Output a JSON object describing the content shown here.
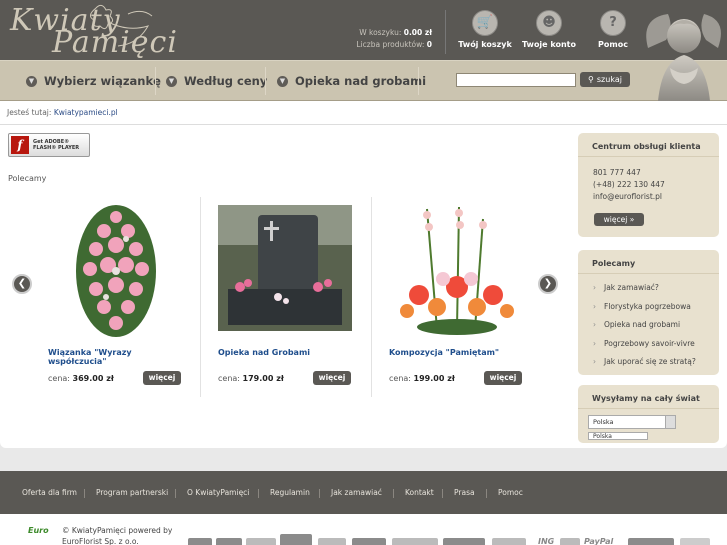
{
  "header": {
    "logo_line1": "Kwiaty",
    "logo_line2": "Pamięci",
    "cart_label": "W koszyku:",
    "cart_value": "0.00 zł",
    "products_label": "Liczba produktów:",
    "products_value": "0",
    "cart_button": "Twój koszyk",
    "account_button": "Twoje konto",
    "help_button": "Pomoc"
  },
  "nav": {
    "items": [
      "Wybierz wiązankę",
      "Według ceny",
      "Opieka nad grobami"
    ],
    "search_placeholder": "",
    "search_button": "szukaj"
  },
  "breadcrumb": {
    "prefix": "Jesteś tutaj:",
    "link": "Kwiatypamieci.pl"
  },
  "flash": {
    "line1": "Get ADOBE®",
    "line2": "FLASH® PLAYER"
  },
  "main": {
    "section_label": "Polecamy",
    "products": [
      {
        "title": "Wiązanka \"Wyrazy współczucia\"",
        "price_label": "cena:",
        "price": "369.00 zł",
        "button": "więcej"
      },
      {
        "title": "Opieka nad Grobami",
        "price_label": "cena:",
        "price": "179.00 zł",
        "button": "więcej"
      },
      {
        "title": "Kompozycja \"Pamiętam\"",
        "price_label": "cena:",
        "price": "199.00 zł",
        "button": "więcej"
      }
    ]
  },
  "sidebar": {
    "service": {
      "title": "Centrum obsługi klienta",
      "phone1": "801 777 447",
      "phone2": "(+48) 222 130 447",
      "email": "info@euroflorist.pl",
      "button": "więcej »"
    },
    "recommended": {
      "title": "Polecamy",
      "links": [
        "Jak zamawiać?",
        "Florystyka pogrzebowa",
        "Opieka nad grobami",
        "Pogrzebowy savoir-vivre",
        "Jak uporać się ze stratą?"
      ]
    },
    "shipping": {
      "title": "Wysyłamy na cały świat",
      "selected": "Polska",
      "second": "Polska"
    }
  },
  "footer": {
    "links": [
      "Oferta dla firm",
      "Program partnerski",
      "O KwiatyPamięci",
      "Regulamin",
      "Jak zamawiać",
      "Kontakt",
      "Prasa",
      "Pomoc"
    ],
    "copyright1": "© KwiatyPamięci powered by",
    "copyright2": "EuroFlorist Sp. z o.o.",
    "euro_logo": "Euro",
    "pay_texts": [
      "PayPal",
      "ING"
    ]
  },
  "colors": {
    "header_bg": "#5a5854",
    "nav_bg": "#cbc4b0",
    "link_blue": "#1f4e8c",
    "sidebar_bg": "#e8e1cf"
  }
}
